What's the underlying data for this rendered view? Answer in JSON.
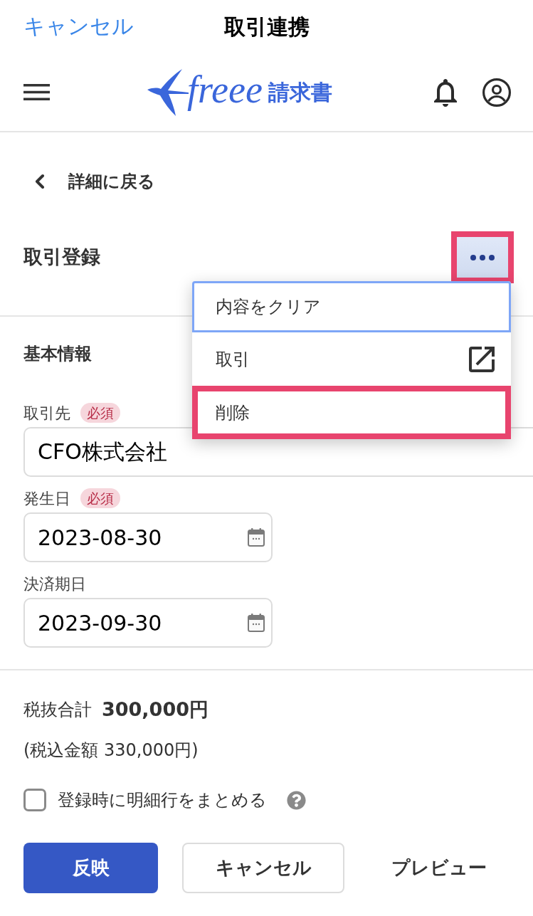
{
  "nav_bar": {
    "cancel": "キャンセル",
    "title": "取引連携"
  },
  "header": {
    "logo": {
      "wordmark": "freee",
      "product": "請求書"
    }
  },
  "back_link": "詳細に戻る",
  "page_title": "取引登録",
  "more_button": {
    "highlighted": true
  },
  "menu": {
    "items": [
      {
        "kind": "plain",
        "label": "内容をクリア",
        "focused": true,
        "highlighted": false
      },
      {
        "kind": "external",
        "label": "取引",
        "focused": false,
        "highlighted": false
      },
      {
        "kind": "plain",
        "label": "削除",
        "focused": false,
        "highlighted": true
      }
    ]
  },
  "section": {
    "title": "基本情報",
    "fields": [
      {
        "kind": "text",
        "label": "取引先",
        "required_badge": "必須",
        "value": "CFO株式会社"
      },
      {
        "kind": "date",
        "label": "発生日",
        "required_badge": "必須",
        "value": "2023-08-30"
      },
      {
        "kind": "date",
        "label": "決済期日",
        "value": "2023-09-30"
      }
    ]
  },
  "totals": {
    "label": "税抜合計",
    "amount": "300,000円",
    "tax_included": "(税込金額 330,000円)"
  },
  "merge_option": {
    "label": "登録時に明細行をまとめる",
    "checked": false
  },
  "actions": [
    {
      "kind": "primary",
      "label": "反映"
    },
    {
      "kind": "outline",
      "label": "キャンセル"
    },
    {
      "kind": "text",
      "label": "プレビュー"
    }
  ]
}
